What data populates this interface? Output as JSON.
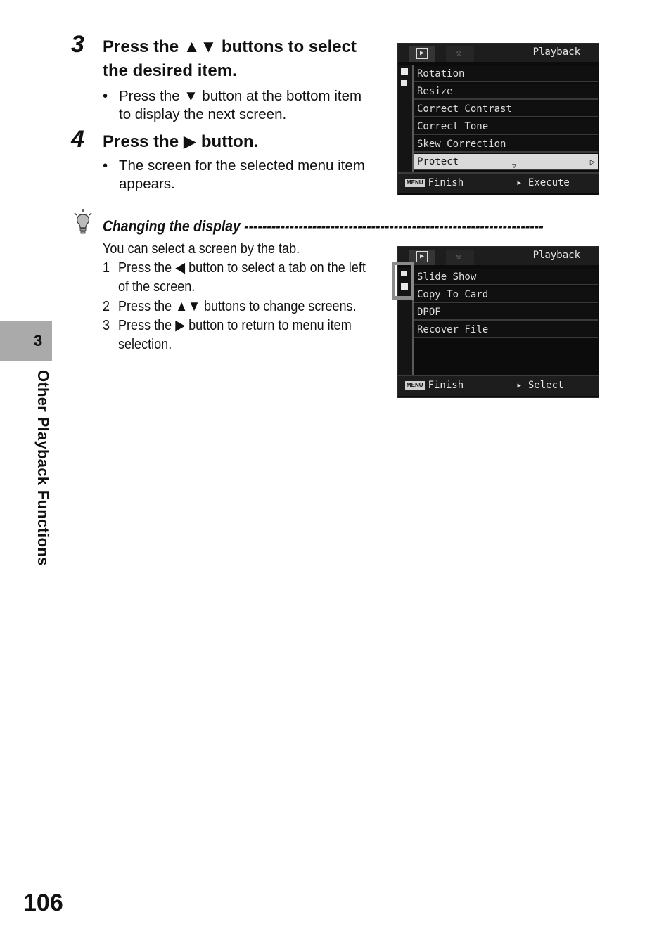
{
  "step3": {
    "number": "3",
    "heading_a": "Press the ",
    "heading_b": " buttons to select",
    "heading_line2": "the desired item.",
    "bullet_a": "Press the ",
    "bullet_b": " button at the bottom item",
    "bullet_line2": "to display the next screen."
  },
  "step4": {
    "number": "4",
    "heading_a": "Press the ",
    "heading_b": " button.",
    "bullet_line1": "The screen for the selected menu item",
    "bullet_line2": "appears."
  },
  "screen1": {
    "title": "Playback",
    "items": [
      "Rotation",
      "Resize",
      "Correct Contrast",
      "Correct Tone",
      "Skew Correction",
      "Protect"
    ],
    "selected_index": 5,
    "finish_label": "Finish",
    "menu_key": "MENU",
    "action_label": "▸ Execute"
  },
  "hint": {
    "title": "Changing the display",
    "dashes": "------------------------------------------------------------------",
    "intro": "You can select a screen by the tab.",
    "item1_num": "1",
    "item1_a": "Press the ",
    "item1_b": " button to select a tab on the left",
    "item1_line2": "of the screen.",
    "item2_num": "2",
    "item2_a": "Press the ",
    "item2_b": " buttons to change screens.",
    "item3_num": "3",
    "item3_a": "Press the ",
    "item3_b": " button to return to menu item",
    "item3_line2": "selection."
  },
  "screen2": {
    "title": "Playback",
    "items": [
      "Slide Show",
      "Copy To Card",
      "DPOF",
      "Recover File"
    ],
    "finish_label": "Finish",
    "menu_key": "MENU",
    "action_label": "▸ Select"
  },
  "sidebar": {
    "chapter_number": "3",
    "chapter_title": "Other Playback Functions"
  },
  "page_number": "106",
  "colors": {
    "screen_bg": "#0c0c0c",
    "side_tab": "#aaaaaa",
    "highlight": "#d9d9d9"
  }
}
